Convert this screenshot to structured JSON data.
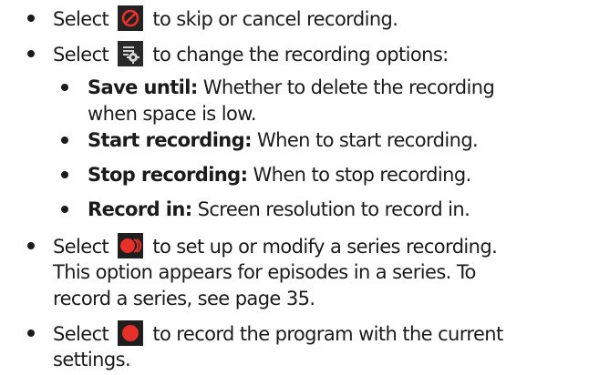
{
  "items": [
    {
      "pre": "Select",
      "icon": "cancel-icon",
      "post": "to skip or cancel recording."
    },
    {
      "pre": "Select",
      "icon": "settings-icon",
      "post": "to change the recording options:"
    },
    {
      "bold": "Save until:",
      "text": "Whether to delete the recording",
      "cont": "when space is low."
    },
    {
      "bold": "Start recording:",
      "text": "When to start recording."
    },
    {
      "bold": "Stop recording:",
      "text": "When to stop recording."
    },
    {
      "bold": "Record in:",
      "text": "Screen resolution to record in."
    },
    {
      "pre": "Select",
      "icon": "series-record-icon",
      "post": "to set up or modify a series recording.",
      "cont1": "This option appears for episodes in a series. To",
      "cont2": "record a series, see page 35."
    },
    {
      "pre": "Select",
      "icon": "record-icon",
      "post": "to record the program with the current",
      "cont": "settings."
    }
  ],
  "colors": {
    "icon_bg": "#1f1f1f",
    "accent_red": "#e8302a"
  }
}
